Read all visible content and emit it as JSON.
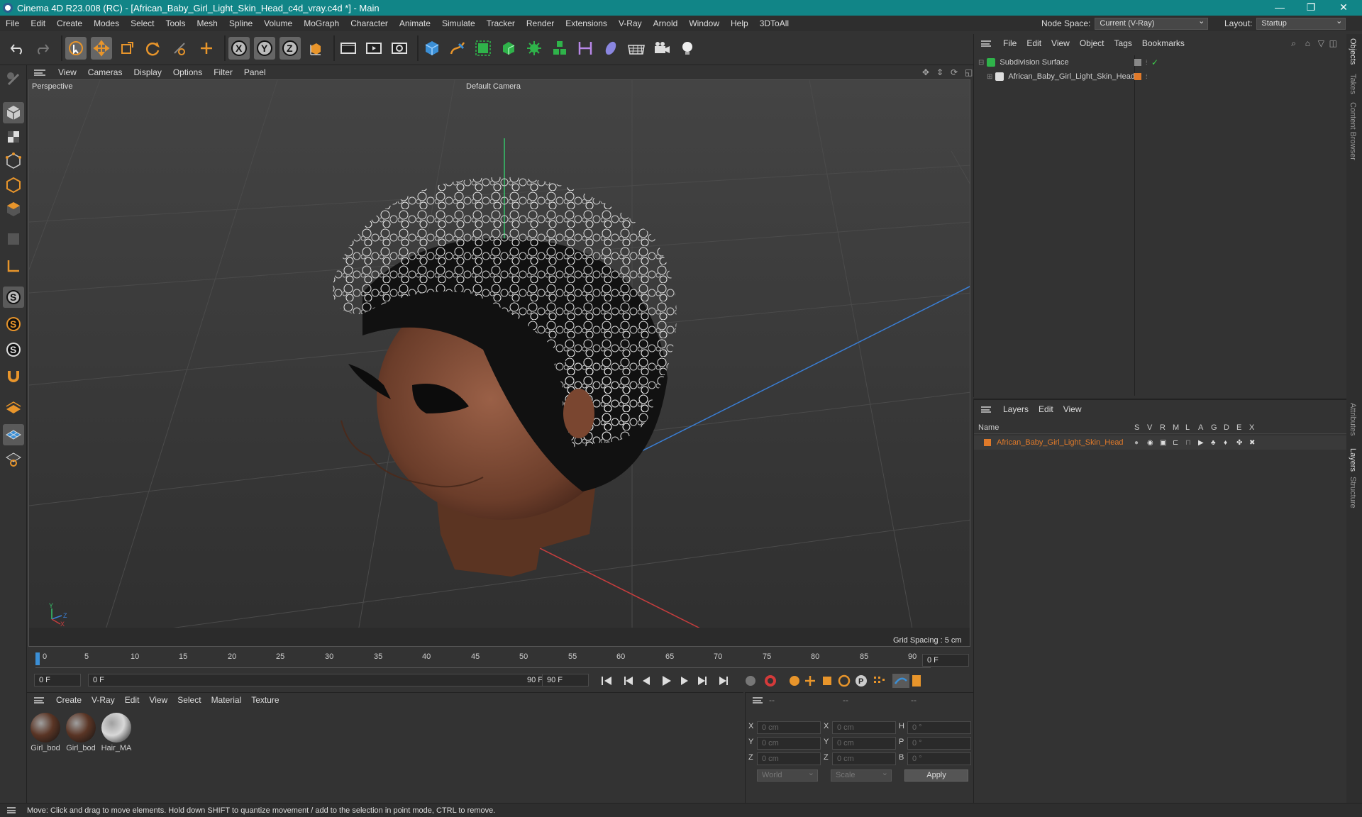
{
  "window": {
    "title": "Cinema 4D R23.008 (RC) - [African_Baby_Girl_Light_Skin_Head_c4d_vray.c4d *] - Main",
    "minimize": "—",
    "maximize": "❐",
    "close": "✕"
  },
  "menubar": {
    "items": [
      "File",
      "Edit",
      "Create",
      "Modes",
      "Select",
      "Tools",
      "Mesh",
      "Spline",
      "Volume",
      "MoGraph",
      "Character",
      "Animate",
      "Simulate",
      "Tracker",
      "Render",
      "Extensions",
      "V-Ray",
      "Arnold",
      "Window",
      "Help",
      "3DToAll"
    ],
    "node_space_label": "Node Space:",
    "node_space_value": "Current (V-Ray)",
    "layout_label": "Layout:",
    "layout_value": "Startup"
  },
  "viewport": {
    "menu": [
      "View",
      "Cameras",
      "Display",
      "Options",
      "Filter",
      "Panel"
    ],
    "view_name": "Perspective",
    "camera_name": "Default Camera",
    "grid_spacing": "Grid Spacing : 5 cm",
    "axis_y": "Y",
    "axis_z": "Z",
    "axis_x": "X"
  },
  "timeline": {
    "ticks": [
      "0",
      "5",
      "10",
      "15",
      "20",
      "25",
      "30",
      "35",
      "40",
      "45",
      "50",
      "55",
      "60",
      "65",
      "70",
      "75",
      "80",
      "85",
      "90"
    ],
    "current_frame_right": "0 F",
    "start_field": "0 F",
    "range_start": "0 F",
    "range_end": "90 F",
    "end_field": "90 F"
  },
  "materials": {
    "menu": [
      "Create",
      "V-Ray",
      "Edit",
      "View",
      "Select",
      "Material",
      "Texture"
    ],
    "items": [
      {
        "name": "Girl_bod",
        "color": "#5a3525"
      },
      {
        "name": "Girl_bod",
        "color": "#5a3525"
      },
      {
        "name": "Hair_MA",
        "color": "#d8d8d8"
      }
    ]
  },
  "coords": {
    "headers": [
      "--",
      "--",
      "--"
    ],
    "rows": [
      {
        "a": "X",
        "av": "0 cm",
        "b": "X",
        "bv": "0 cm",
        "c": "H",
        "cv": "0 °"
      },
      {
        "a": "Y",
        "av": "0 cm",
        "b": "Y",
        "bv": "0 cm",
        "c": "P",
        "cv": "0 °"
      },
      {
        "a": "Z",
        "av": "0 cm",
        "b": "Z",
        "bv": "0 cm",
        "c": "B",
        "cv": "0 °"
      }
    ],
    "coord_system": "World",
    "mode": "Scale",
    "apply": "Apply"
  },
  "objects": {
    "menu": [
      "File",
      "Edit",
      "View",
      "Object",
      "Tags",
      "Bookmarks"
    ],
    "items": [
      {
        "name": "Subdivision Surface",
        "color": "#ddd"
      },
      {
        "name": "African_Baby_Girl_Light_Skin_Head",
        "color": "#ddd"
      }
    ]
  },
  "layers": {
    "menu": [
      "Layers",
      "Edit",
      "View"
    ],
    "col_name": "Name",
    "cols": [
      "S",
      "V",
      "R",
      "M",
      "L",
      "A",
      "G",
      "D",
      "E",
      "X"
    ],
    "items": [
      {
        "name": "African_Baby_Girl_Light_Skin_Head",
        "color": "#e07a2a"
      }
    ]
  },
  "side_tabs": [
    "Objects",
    "Takes",
    "Content Browser",
    "Attributes",
    "Layers",
    "Structure"
  ],
  "status": "Move: Click and drag to move elements. Hold down SHIFT to quantize movement / add to the selection in point mode, CTRL to remove.",
  "colors": {
    "accent": "#118587",
    "orange": "#e8952b",
    "blue": "#3b8fd6"
  }
}
